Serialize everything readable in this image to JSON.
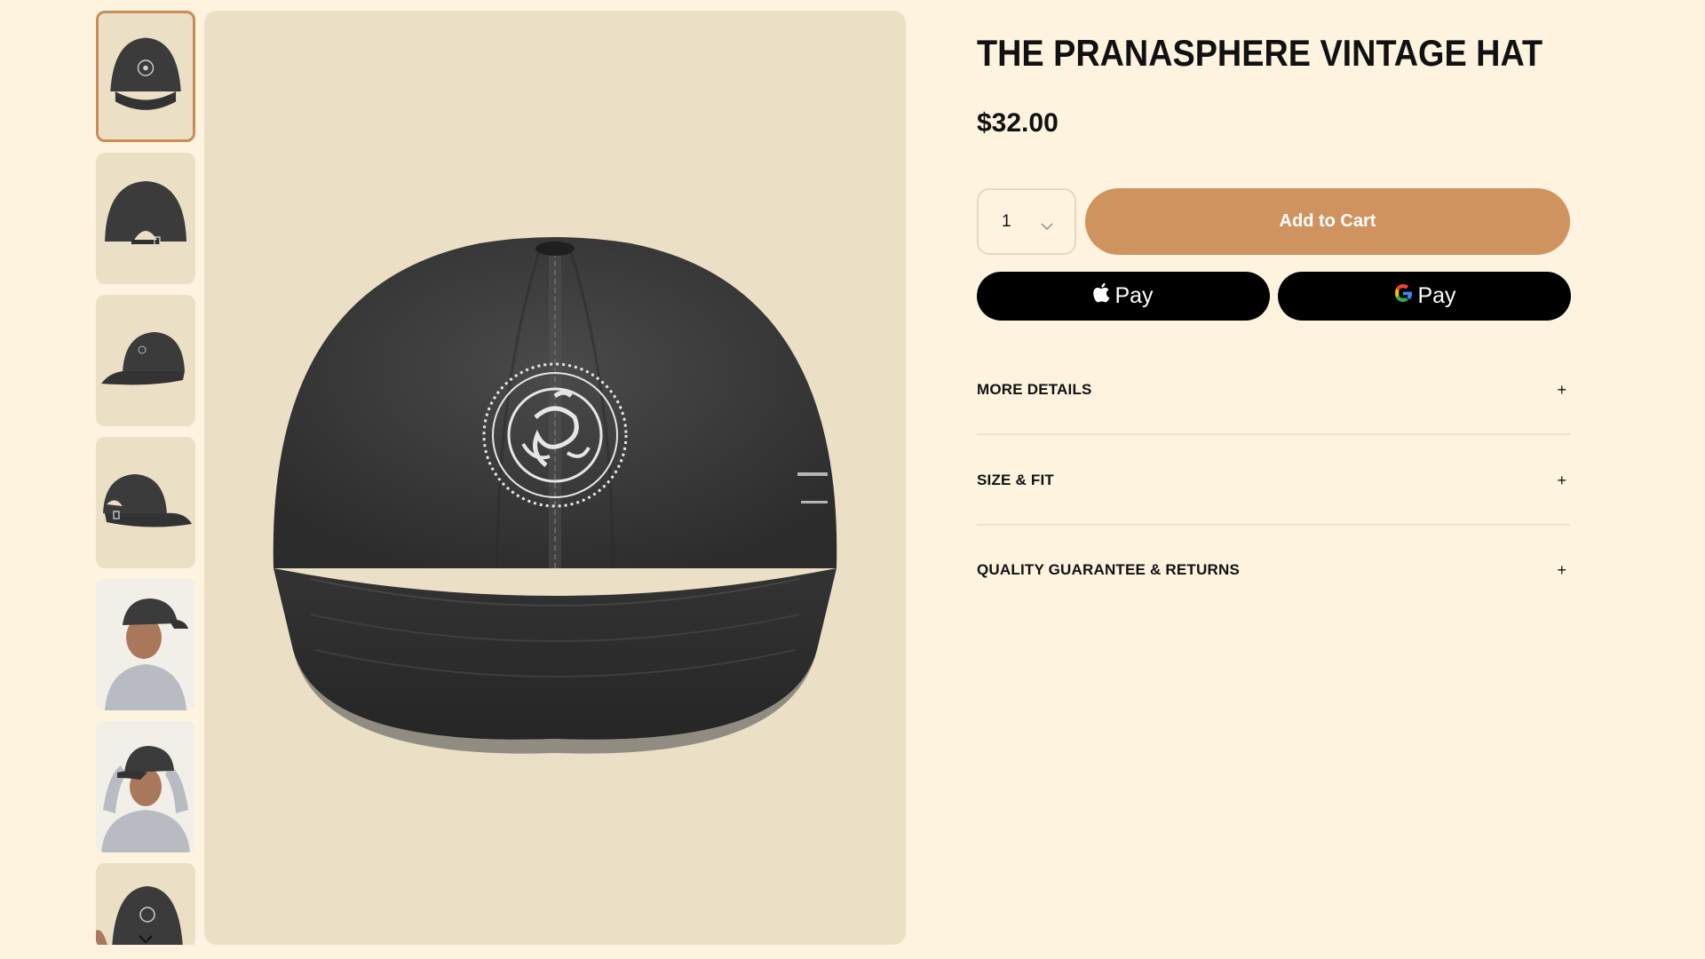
{
  "product": {
    "title": "THE PRANASPHERE VINTAGE HAT",
    "price": "$32.00"
  },
  "purchase": {
    "quantity": "1",
    "add_to_cart_label": "Add to Cart",
    "apple_pay_label": "Pay",
    "google_pay_label": "Pay"
  },
  "accordion": [
    {
      "label": "MORE DETAILS",
      "icon": "+"
    },
    {
      "label": "SIZE & FIT",
      "icon": "+"
    },
    {
      "label": "QUALITY GUARANTEE & RETURNS",
      "icon": "+"
    }
  ],
  "gallery": {
    "thumbnails": [
      {
        "view": "front",
        "selected": true
      },
      {
        "view": "back",
        "selected": false
      },
      {
        "view": "side-left",
        "selected": false
      },
      {
        "view": "side-right",
        "selected": false
      },
      {
        "view": "model-front",
        "selected": false
      },
      {
        "view": "model-adjusting",
        "selected": false
      },
      {
        "view": "front-partial",
        "selected": false
      }
    ]
  },
  "colors": {
    "background": "#fdf3df",
    "image_bg": "#ebdfc6",
    "accent": "#cf935f",
    "hat": "#3a3a3a"
  }
}
